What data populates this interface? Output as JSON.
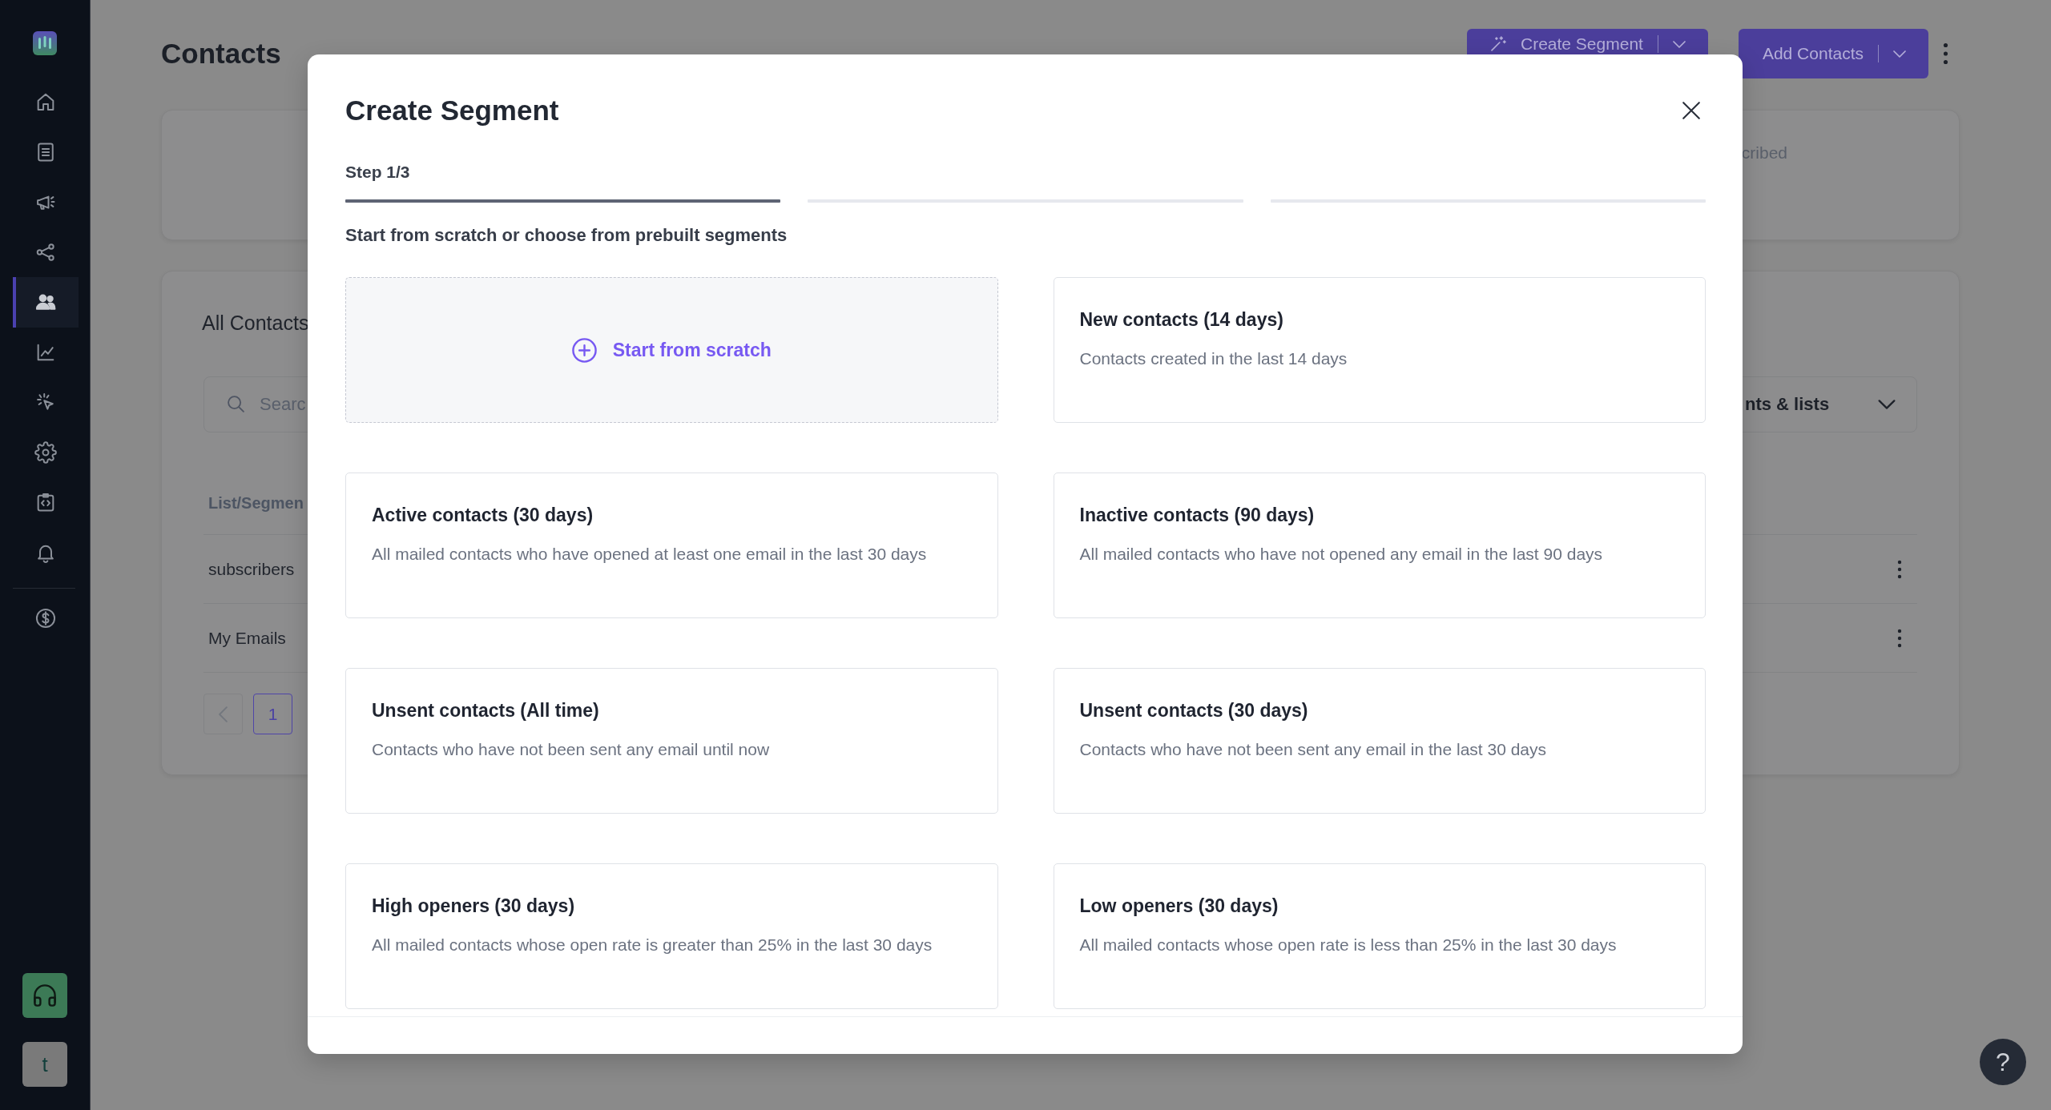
{
  "sidebar": {
    "nav": [
      {
        "selected": false
      },
      {
        "selected": false
      },
      {
        "selected": false
      },
      {
        "selected": false
      },
      {
        "selected": true
      },
      {
        "selected": false
      },
      {
        "selected": false
      },
      {
        "selected": false
      },
      {
        "selected": false
      },
      {
        "selected": false
      }
    ],
    "secondary_nav": [
      {
        "selected": false
      }
    ],
    "avatar": {
      "initial": "t"
    }
  },
  "header": {
    "title": "Contacts",
    "actions": [
      {
        "label": "Create Segment",
        "kind": "magic"
      },
      {
        "label": "Add Contacts",
        "kind": "plain"
      }
    ]
  },
  "summary_card": {
    "label": "cribed"
  },
  "contacts_card": {
    "title": "All Contacts",
    "search": {
      "placeholder": "Searc"
    },
    "filter": {
      "value": "nts & lists"
    },
    "table": {
      "columns": [
        "List/Segmen"
      ],
      "rows": [
        [
          "subscribers"
        ],
        [
          "My Emails"
        ]
      ]
    },
    "pagination": {
      "pages": [
        {
          "label": "1",
          "selected": true
        }
      ]
    }
  },
  "modal": {
    "title": "Create Segment",
    "step_label": "Step 1/3",
    "steps": [
      {
        "active": true
      },
      {
        "active": false
      },
      {
        "active": false
      }
    ],
    "subtitle": "Start from scratch or choose from prebuilt segments",
    "options": [
      {
        "kind": "scratch",
        "title": "Start from scratch"
      },
      {
        "kind": "preset",
        "title": "New contacts (14 days)",
        "description": "Contacts created in the last 14 days"
      },
      {
        "kind": "preset",
        "title": "Active contacts (30 days)",
        "description": "All mailed contacts who have opened at least one email in the last 30 days"
      },
      {
        "kind": "preset",
        "title": "Inactive contacts (90 days)",
        "description": "All mailed contacts who have not opened any email in the last 90 days"
      },
      {
        "kind": "preset",
        "title": "Unsent contacts (All time)",
        "description": "Contacts who have not been sent any email until now"
      },
      {
        "kind": "preset",
        "title": "Unsent contacts (30 days)",
        "description": "Contacts who have not been sent any email in the last 30 days"
      },
      {
        "kind": "preset",
        "title": "High openers (30 days)",
        "description": "All mailed contacts whose open rate is greater than 25% in the last 30 days"
      },
      {
        "kind": "preset",
        "title": "Low openers (30 days)",
        "description": "All mailed contacts whose open rate is less than 25% in the last 30 days"
      }
    ]
  },
  "help": {
    "label": "?"
  }
}
